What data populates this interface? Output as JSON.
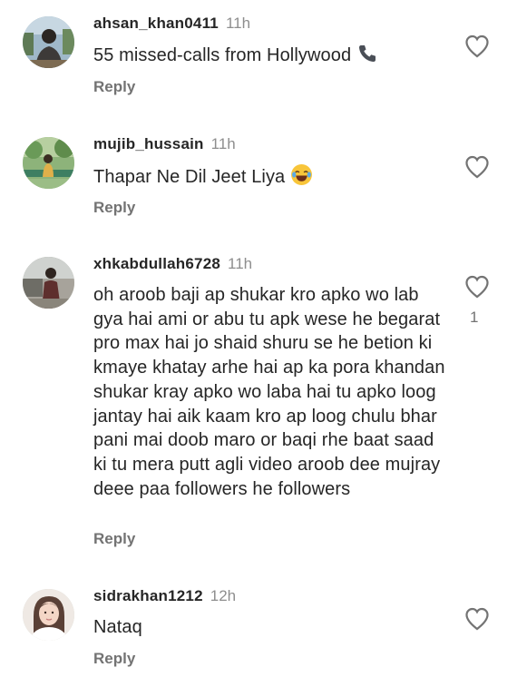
{
  "comments": [
    {
      "username": "ahsan_khan0411",
      "time": "11h",
      "text": "55 missed-calls from Hollywood",
      "emoji": "phone-icon",
      "reply_label": "Reply",
      "like_count": ""
    },
    {
      "username": "mujib_hussain",
      "time": "11h",
      "text": "Thapar Ne Dil Jeet Liya",
      "emoji": "laughing-emoji",
      "reply_label": "Reply",
      "like_count": ""
    },
    {
      "username": "xhkabdullah6728",
      "time": "11h",
      "text": "oh aroob baji ap shukar kro apko wo lab gya hai ami or abu tu apk wese he begarat pro max hai jo shaid shuru se he betion ki kmaye khatay arhe hai ap ka pora khandan shukar kray apko wo laba hai tu apko loog jantay hai aik kaam kro ap loog chulu bhar pani mai doob maro or baqi rhe baat saad ki tu mera putt agli video aroob dee mujray deee paa followers he followers",
      "reply_label": "Reply",
      "like_count": "1"
    },
    {
      "username": "sidrakhan1212",
      "time": "12h",
      "text": "Nataq",
      "reply_label": "Reply",
      "like_count": ""
    }
  ],
  "colors": {
    "text": "#262626",
    "secondary": "#8e8e8e",
    "reply": "#737373"
  }
}
